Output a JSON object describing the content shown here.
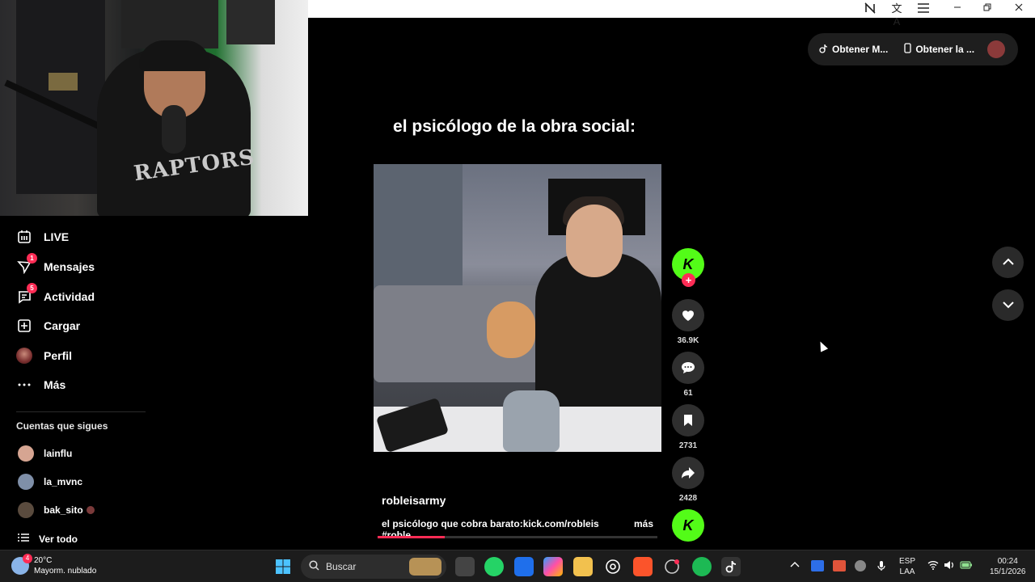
{
  "video": {
    "caption_top": "el psicólogo de la obra social:",
    "author": "robleisarmy",
    "description": "el psicólogo que cobra barato:kick.com/robleis #roble...",
    "more_label": "más",
    "progress": 0.24
  },
  "nav": [
    {
      "label": "LIVE",
      "icon": "live-icon"
    },
    {
      "label": "Mensajes",
      "icon": "message-icon",
      "badge": "1"
    },
    {
      "label": "Actividad",
      "icon": "activity-icon",
      "badge": "5"
    },
    {
      "label": "Cargar",
      "icon": "upload-icon"
    },
    {
      "label": "Perfil",
      "icon": "profile-avatar"
    },
    {
      "label": "Más",
      "icon": "more-icon"
    }
  ],
  "following": {
    "title": "Cuentas que sigues",
    "accounts": [
      "lainflu",
      "la_mvnc",
      "bak_sito"
    ],
    "see_all": "Ver todo"
  },
  "actions": {
    "likes": "36.9K",
    "comments": "61",
    "saves": "2731",
    "shares": "2428"
  },
  "top_pill": {
    "item1": "Obtener M...",
    "item2": "Obtener la ..."
  },
  "taskbar": {
    "temp": "20°C",
    "weather": "Mayorm. nublado",
    "weather_badge": "4",
    "search": "Buscar",
    "lang1": "ESP",
    "lang2": "LAA",
    "time": "00:24",
    "date": "15/1/2026"
  },
  "colors": {
    "accent": "#fe2c55",
    "kick": "#53fc18"
  }
}
